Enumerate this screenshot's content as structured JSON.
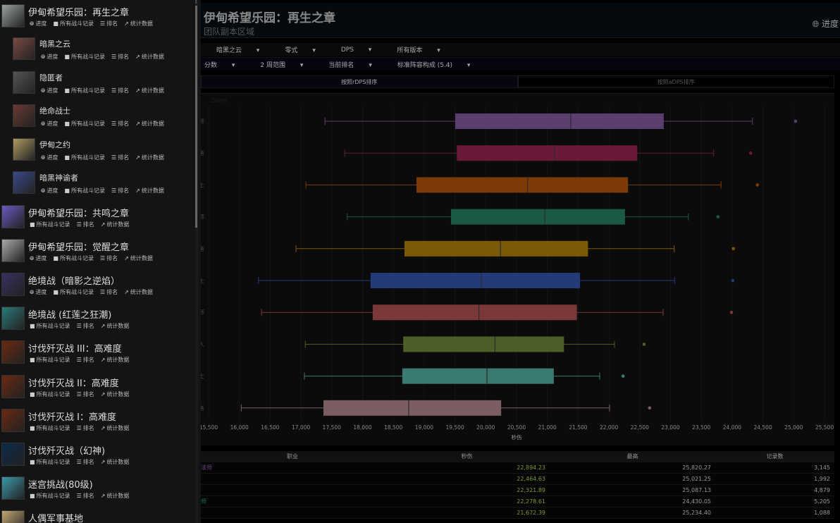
{
  "sidebar": {
    "zones": [
      {
        "title": "伊甸希望乐园：再生之章",
        "links": [
          "进度",
          "所有战斗记录",
          "排名",
          "统计数据"
        ],
        "sub": false,
        "img": "#9aa0a0"
      },
      {
        "title": "暗黑之云",
        "links": [
          "进度",
          "所有战斗记录",
          "排名",
          "统计数据"
        ],
        "sub": true,
        "img": "#7a4a44"
      },
      {
        "title": "隐匿者",
        "links": [
          "进度",
          "所有战斗记录",
          "排名",
          "统计数据"
        ],
        "sub": true,
        "img": "#555"
      },
      {
        "title": "绝命战士",
        "links": [
          "进度",
          "所有战斗记录",
          "排名",
          "统计数据"
        ],
        "sub": true,
        "img": "#6a3a32"
      },
      {
        "title": "伊甸之约",
        "links": [
          "进度",
          "所有战斗记录",
          "排名",
          "统计数据"
        ],
        "sub": true,
        "img": "#b09a60"
      },
      {
        "title": "暗黑神谕者",
        "links": [
          "进度",
          "所有战斗记录",
          "排名",
          "统计数据"
        ],
        "sub": true,
        "img": "#3a4a8a"
      },
      {
        "title": "伊甸希望乐园：共鸣之章",
        "links": [
          "所有战斗记录",
          "排名",
          "统计数据"
        ],
        "sub": false,
        "img": "#6a5ac0"
      },
      {
        "title": "伊甸希望乐园：觉醒之章",
        "links": [
          "进度",
          "所有战斗记录",
          "排名",
          "统计数据"
        ],
        "sub": false,
        "img": "#aaaaaa"
      },
      {
        "title": "绝境战（暗影之逆焰）",
        "links": [
          "进度",
          "所有战斗记录",
          "排名",
          "统计数据"
        ],
        "sub": false,
        "img": "#3a3060"
      },
      {
        "title": "绝境战 (红莲之狂潮)",
        "links": [
          "所有战斗记录",
          "排名",
          "统计数据"
        ],
        "sub": false,
        "img": "#2a7a78"
      },
      {
        "title": "讨伐歼灭战 III：高难度",
        "links": [
          "所有战斗记录",
          "排名",
          "统计数据"
        ],
        "sub": false,
        "img": "#6a2a10"
      },
      {
        "title": "讨伐歼灭战 II：高难度",
        "links": [
          "所有战斗记录",
          "排名",
          "统计数据"
        ],
        "sub": false,
        "img": "#6a2a10"
      },
      {
        "title": "讨伐歼灭战 I：高难度",
        "links": [
          "所有战斗记录",
          "排名",
          "统计数据"
        ],
        "sub": false,
        "img": "#6a2a10"
      },
      {
        "title": "讨伐歼灭战（幻神)",
        "links": [
          "所有战斗记录",
          "排名",
          "统计数据"
        ],
        "sub": false,
        "img": "#0a2a4a"
      },
      {
        "title": "迷宫挑战(80级)",
        "links": [
          "所有战斗记录",
          "排名",
          "统计数据"
        ],
        "sub": false,
        "img": "#3a9aaa"
      },
      {
        "title": "人偶军事基地",
        "links": [],
        "sub": false,
        "img": "#c0a870"
      }
    ]
  },
  "header": {
    "title": "伊甸希望乐园：再生之章",
    "subtitle": "团队副本区域",
    "progress": "进度"
  },
  "filters1": [
    "暗黑之云",
    "零式",
    "DPS",
    "所有版本"
  ],
  "filters2": [
    "分数",
    "2 周范围",
    "当前排名",
    "标准阵容构成 (5.4)"
  ],
  "tabs": [
    "按照rDPS排序",
    "按照aDPS排序"
  ],
  "chart_data": {
    "type": "box",
    "title": "",
    "zoom_label": "Zoom",
    "xlabel": "秒伤",
    "xlim": [
      15500,
      25500
    ],
    "xticks": [
      "15,500",
      "16,000",
      "16,500",
      "17,000",
      "17,500",
      "18,000",
      "18,500",
      "19,000",
      "19,500",
      "20,000",
      "20,500",
      "21,000",
      "21,500",
      "22,000",
      "22,500",
      "23,000",
      "23,500",
      "24,000",
      "24,500",
      "25,000",
      "25,500"
    ],
    "rows": [
      {
        "label": "师",
        "color": "#5a3e6e",
        "min": 17390,
        "q1": 19505,
        "median": 21380,
        "q3": 22890,
        "max": 24330,
        "outlier": 25030
      },
      {
        "label": "者",
        "color": "#6a1a38",
        "min": 17710,
        "q1": 19530,
        "median": 21120,
        "q3": 22460,
        "max": 23700,
        "outlier": 24300
      },
      {
        "label": "士",
        "color": "#7e3a06",
        "min": 17080,
        "q1": 18875,
        "median": 20680,
        "q3": 22310,
        "max": 23820,
        "outlier": 24410
      },
      {
        "label": "师",
        "color": "#1c5a44",
        "min": 17750,
        "q1": 19435,
        "median": 20960,
        "q3": 22260,
        "max": 23290,
        "outlier": 23770
      },
      {
        "label": "者",
        "color": "#7a5a06",
        "min": 16920,
        "q1": 18680,
        "median": 20240,
        "q3": 21660,
        "max": 23060,
        "outlier": 24020
      },
      {
        "label": "士",
        "color": "#253a78",
        "min": 16310,
        "q1": 18130,
        "median": 19930,
        "q3": 21530,
        "max": 23070,
        "outlier": 24010
      },
      {
        "label": "师",
        "color": "#7a3838",
        "min": 16360,
        "q1": 18165,
        "median": 19890,
        "q3": 21480,
        "max": 22880,
        "outlier": 23990
      },
      {
        "label": "人",
        "color": "#4e5e28",
        "min": 17070,
        "q1": 18660,
        "median": 20150,
        "q3": 21270,
        "max": 22090,
        "outlier": 22570
      },
      {
        "label": "士",
        "color": "#3a7a70",
        "min": 17055,
        "q1": 18645,
        "median": 20020,
        "q3": 21105,
        "max": 21850,
        "outlier": 22230
      },
      {
        "label": "者",
        "color": "#7a5e62",
        "min": 16030,
        "q1": 17365,
        "median": 18750,
        "q3": 20250,
        "max": 22010,
        "outlier": 22660
      }
    ]
  },
  "table": {
    "headers": [
      "职业",
      "秒伤",
      "最高",
      "记录数"
    ],
    "rows": [
      {
        "job": "法师",
        "job_color": "#6a4a8a",
        "dps": "22,894.23",
        "max": "25,820.27",
        "count": "3,145"
      },
      {
        "job": "",
        "job_color": "#888",
        "dps": "22,464.63",
        "max": "25,021.25",
        "count": "1,992"
      },
      {
        "job": "",
        "job_color": "#888",
        "dps": "22,321.89",
        "max": "25,087.13",
        "count": "4,879"
      },
      {
        "job": "师",
        "job_color": "#1c7a54",
        "dps": "22,278.61",
        "max": "24,430.05",
        "count": "5,205"
      },
      {
        "job": "",
        "job_color": "#888",
        "dps": "21,672.39",
        "max": "25,234.40",
        "count": "1,088"
      }
    ]
  }
}
